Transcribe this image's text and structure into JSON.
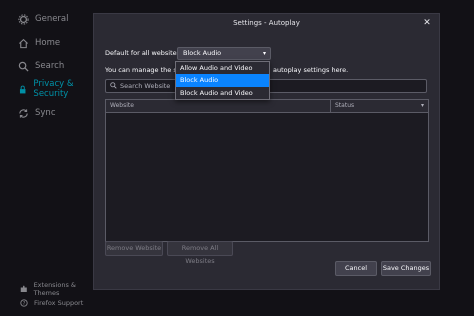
{
  "sidebar": {
    "items": [
      {
        "label": "General",
        "icon": "gear-icon",
        "active": false
      },
      {
        "label": "Home",
        "icon": "home-icon",
        "active": false
      },
      {
        "label": "Search",
        "icon": "search-icon",
        "active": false
      },
      {
        "label": "Privacy & Security",
        "icon": "lock-icon",
        "active": true
      },
      {
        "label": "Sync",
        "icon": "sync-icon",
        "active": false
      }
    ],
    "footer": [
      {
        "label": "Extensions & Themes",
        "icon": "puzzle-icon"
      },
      {
        "label": "Firefox Support",
        "icon": "help-icon"
      }
    ]
  },
  "dialog": {
    "title": "Settings - Autoplay",
    "close_label": "✕",
    "default_label": "Default for all websites:",
    "default_value": "Block Audio",
    "manage_text_a": "You can manage the site",
    "manage_text_b": "autoplay settings here.",
    "search_placeholder": "Search Website",
    "table": {
      "col_website": "Website",
      "col_status": "Status",
      "rows": []
    },
    "remove_website": "Remove Website",
    "remove_all": "Remove All Websites",
    "cancel": "Cancel",
    "save": "Save Changes"
  },
  "dropdown_menu": {
    "options": [
      "Allow Audio and Video",
      "Block Audio",
      "Block Audio and Video"
    ],
    "selected": "Block Audio"
  },
  "colors": {
    "accent": "#00ddff",
    "selection": "#0a84ff",
    "dialog_bg": "#2b2a33",
    "page_bg": "#1c1b22"
  }
}
